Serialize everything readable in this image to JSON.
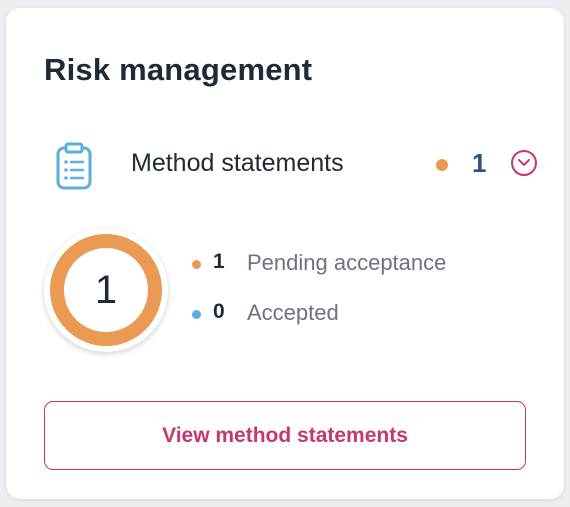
{
  "card": {
    "title": "Risk management"
  },
  "section": {
    "label": "Method statements",
    "count": "1",
    "icon": "clipboard-icon",
    "expand_icon": "chevron-down-icon"
  },
  "summary": {
    "total": "1",
    "legend": [
      {
        "count": "1",
        "label": "Pending acceptance",
        "color": "#ea9a52"
      },
      {
        "count": "0",
        "label": "Accepted",
        "color": "#5aaee0"
      }
    ]
  },
  "actions": {
    "view_label": "View method statements"
  },
  "colors": {
    "accent": "#c7376e",
    "pending": "#ea9a52",
    "accepted": "#5aaee0",
    "count_blue": "#2f4f89",
    "icon_blue": "#5aaee0"
  }
}
